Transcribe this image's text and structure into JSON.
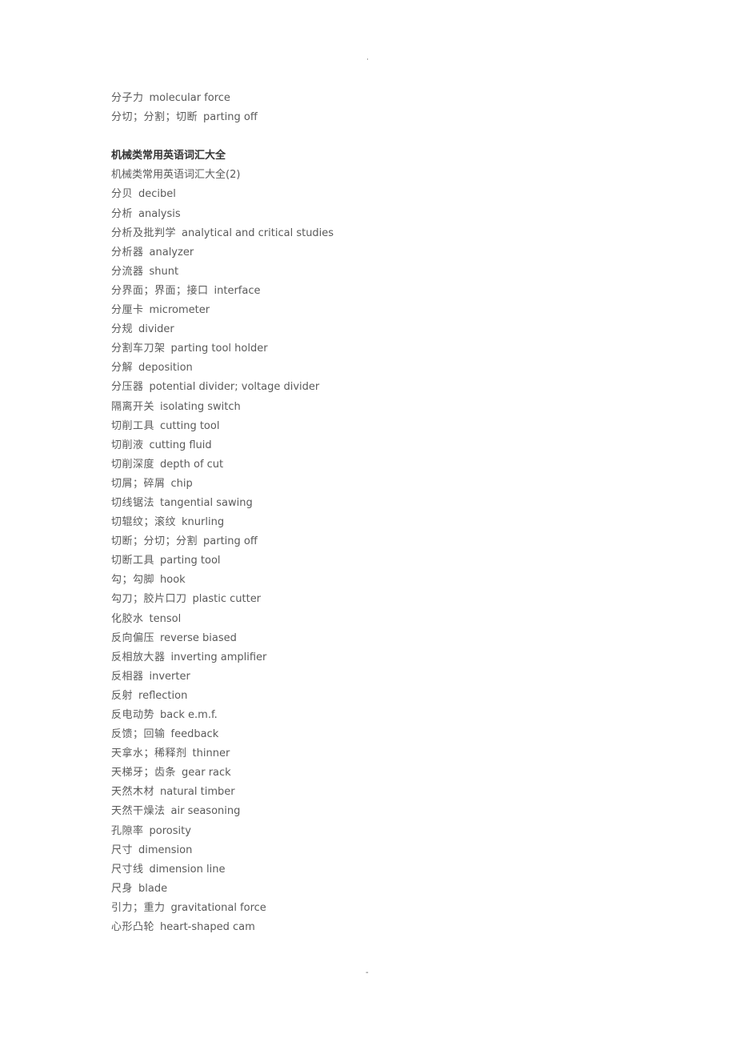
{
  "header_mark": "·",
  "footer_mark": "-",
  "intro_entries": [
    {
      "zh": "分子力",
      "en": "molecular force"
    },
    {
      "zh": "分切；分割；切断",
      "en": "parting off"
    }
  ],
  "section_title": "机械类常用英语词汇大全",
  "section_subtitle": "机械类常用英语词汇大全(2)",
  "entries": [
    {
      "zh": "分贝",
      "en": "decibel"
    },
    {
      "zh": "分析",
      "en": "analysis"
    },
    {
      "zh": "分析及批判学",
      "en": "analytical and critical studies"
    },
    {
      "zh": "分析器",
      "en": "analyzer"
    },
    {
      "zh": "分流器",
      "en": "shunt"
    },
    {
      "zh": "分界面；界面；接口",
      "en": "interface"
    },
    {
      "zh": "分厘卡",
      "en": "micrometer"
    },
    {
      "zh": "分规",
      "en": "divider"
    },
    {
      "zh": "分割车刀架",
      "en": "parting tool holder"
    },
    {
      "zh": "分解",
      "en": "deposition"
    },
    {
      "zh": "分压器",
      "en": "potential divider; voltage divider"
    },
    {
      "zh": "隔离开关",
      "en": "isolating switch"
    },
    {
      "zh": "切削工具",
      "en": "cutting tool"
    },
    {
      "zh": "切削液",
      "en": "cutting fluid"
    },
    {
      "zh": "切削深度",
      "en": "depth of cut"
    },
    {
      "zh": "切屑；碎屑",
      "en": "chip"
    },
    {
      "zh": "切线锯法",
      "en": "tangential sawing"
    },
    {
      "zh": "切辊纹；滚纹",
      "en": "knurling"
    },
    {
      "zh": "切断；分切；分割",
      "en": "parting off"
    },
    {
      "zh": "切断工具",
      "en": "parting tool"
    },
    {
      "zh": "勾；勾脚",
      "en": "hook"
    },
    {
      "zh": "勾刀；胶片口刀",
      "en": "plastic cutter"
    },
    {
      "zh": "化胶水",
      "en": "tensol"
    },
    {
      "zh": "反向偏压",
      "en": "reverse biased"
    },
    {
      "zh": "反相放大器",
      "en": "inverting amplifier"
    },
    {
      "zh": "反相器",
      "en": "inverter"
    },
    {
      "zh": "反射",
      "en": "reflection"
    },
    {
      "zh": "反电动势",
      "en": "back e.m.f."
    },
    {
      "zh": "反馈；回输",
      "en": "feedback"
    },
    {
      "zh": "天拿水；稀释剂",
      "en": "thinner"
    },
    {
      "zh": "天梯牙；齿条",
      "en": "gear rack"
    },
    {
      "zh": "天然木材",
      "en": "natural timber"
    },
    {
      "zh": "天然干燥法",
      "en": "air seasoning"
    },
    {
      "zh": "孔隙率",
      "en": "porosity"
    },
    {
      "zh": "尺寸",
      "en": "dimension"
    },
    {
      "zh": "尺寸线",
      "en": "dimension line"
    },
    {
      "zh": "尺身",
      "en": "blade"
    },
    {
      "zh": "引力；重力",
      "en": "gravitational force"
    },
    {
      "zh": "心形凸轮",
      "en": "heart-shaped cam"
    }
  ]
}
